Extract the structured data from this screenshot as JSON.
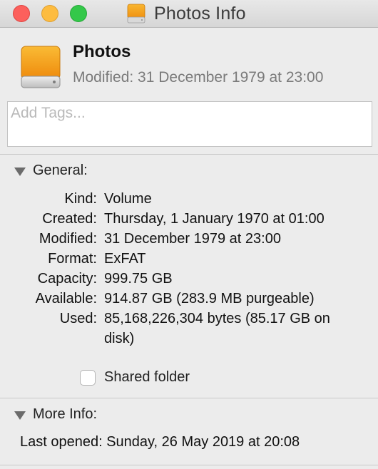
{
  "window": {
    "title": "Photos Info",
    "title_icon": "orange-drive-icon",
    "controls": [
      "close",
      "minimize",
      "zoom"
    ]
  },
  "header": {
    "name": "Photos",
    "modified": "Modified: 31 December 1979 at 23:00",
    "icon": "orange-drive-icon",
    "tags_placeholder": "Add Tags..."
  },
  "general": {
    "heading": "General:",
    "rows": [
      {
        "label": "Kind:",
        "value": "Volume"
      },
      {
        "label": "Created:",
        "value": "Thursday, 1 January 1970 at 01:00"
      },
      {
        "label": "Modified:",
        "value": "31 December 1979 at 23:00"
      },
      {
        "label": "Format:",
        "value": "ExFAT"
      },
      {
        "label": "Capacity:",
        "value": "999.75 GB"
      },
      {
        "label": "Available:",
        "value": "914.87 GB (283.9 MB purgeable)"
      },
      {
        "label": "Used:",
        "value": "85,168,226,304 bytes (85.17 GB on disk)"
      }
    ],
    "shared_folder_label": "Shared folder",
    "shared_folder_checked": false
  },
  "more_info": {
    "heading": "More Info:",
    "last_opened": "Last opened: Sunday, 26 May 2019 at 20:08"
  },
  "colors": {
    "close": "#fc605c",
    "minimize": "#fdbc40",
    "zoom": "#34c84a",
    "drive_orange": "#f7a51b"
  }
}
